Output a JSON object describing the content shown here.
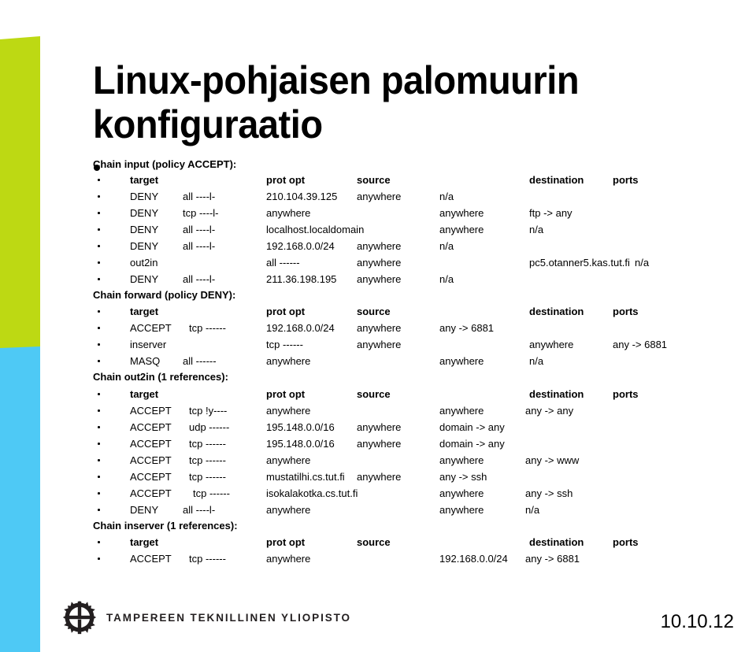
{
  "slide": {
    "title": "Linux-pohjaisen palomuurin konfiguraatio",
    "date": "10.10.12",
    "colors": {
      "accent_green": "#bdd913",
      "accent_blue": "#4ec9f5",
      "text": "#000000"
    }
  },
  "footer": {
    "wordmark": "TAMPEREEN TEKNILLINEN YLIOPISTO",
    "logo_icon": "gear-icon"
  },
  "sections": [
    {
      "heading": "Chain input (policy ACCEPT):",
      "columns": [
        "target",
        "prot opt",
        "source",
        "destination",
        "ports"
      ],
      "rows": [
        {
          "target": "DENY",
          "prot": "all  ----l-",
          "source": "210.104.39.125",
          "extra": "anywhere",
          "destination": "n/a",
          "ports": ""
        },
        {
          "target": "DENY",
          "prot": "tcp  ----l-",
          "source": "anywhere",
          "extra": "",
          "destination": "anywhere",
          "ports": "ftp ->   any"
        },
        {
          "target": "DENY",
          "prot": "all  ----l-",
          "source": "localhost.localdomain",
          "extra": "",
          "destination": "anywhere",
          "ports": "n/a"
        },
        {
          "target": "DENY",
          "prot": "all  ----l-",
          "source": "192.168.0.0/24",
          "extra": "anywhere",
          "destination": "n/a",
          "ports": ""
        },
        {
          "target": "out2in",
          "prot": "",
          "source": "all  ------",
          "extra": "anywhere",
          "destination": "pc5.otanner5.kas.tut.fi",
          "ports": "n/a"
        },
        {
          "target": "DENY",
          "prot": "all  ----l-",
          "source": "211.36.198.195",
          "extra": "anywhere",
          "destination": "n/a",
          "ports": ""
        }
      ]
    },
    {
      "heading": "Chain forward (policy DENY):",
      "columns": [
        "target",
        "prot opt",
        "source",
        "destination",
        "ports"
      ],
      "rows": [
        {
          "target": "ACCEPT",
          "prot": "tcp  ------",
          "source": "192.168.0.0/24",
          "extra": "anywhere",
          "destination": "any ->   6881",
          "ports": ""
        },
        {
          "target": "inserver",
          "prot": "",
          "source": "tcp  ------",
          "extra": "anywhere",
          "destination": "anywhere",
          "ports": "any ->   6881"
        },
        {
          "target": "MASQ",
          "prot": "all  ------",
          "source": "anywhere",
          "extra": "",
          "destination": "anywhere",
          "ports": "n/a"
        }
      ]
    },
    {
      "heading": "Chain out2in (1 references):",
      "columns": [
        "target",
        "prot opt",
        "source",
        "destination",
        "ports"
      ],
      "rows": [
        {
          "target": "ACCEPT",
          "prot": "tcp  !y----",
          "source": "anywhere",
          "extra": "",
          "destination": "anywhere",
          "ports": "any ->   any"
        },
        {
          "target": "ACCEPT",
          "prot": "udp  ------",
          "source": "195.148.0.0/16",
          "extra": "anywhere",
          "destination": "domain ->   any",
          "ports": ""
        },
        {
          "target": "ACCEPT",
          "prot": "tcp  ------",
          "source": "195.148.0.0/16",
          "extra": "anywhere",
          "destination": "domain ->   any",
          "ports": ""
        },
        {
          "target": "ACCEPT",
          "prot": "tcp  ------",
          "source": "anywhere",
          "extra": "",
          "destination": "anywhere",
          "ports": "any ->   www"
        },
        {
          "target": "ACCEPT",
          "prot": "tcp  ------",
          "source": "mustatilhi.cs.tut.fi",
          "extra": "anywhere",
          "destination": "any ->   ssh",
          "ports": ""
        },
        {
          "target": "ACCEPT",
          "prot": "tcp  ------",
          "source": "isokalakotka.cs.tut.fi",
          "extra": "",
          "destination": "anywhere",
          "ports": "any ->   ssh"
        },
        {
          "target": "DENY",
          "prot": "all  ----l-",
          "source": "anywhere",
          "extra": "",
          "destination": "anywhere",
          "ports": "n/a"
        }
      ]
    },
    {
      "heading": "Chain inserver (1 references):",
      "columns": [
        "target",
        "prot opt",
        "source",
        "destination",
        "ports"
      ],
      "rows": [
        {
          "target": "ACCEPT",
          "prot": "tcp  ------",
          "source": "anywhere",
          "extra": "",
          "destination": "192.168.0.0/24",
          "ports": "any ->   6881"
        }
      ]
    }
  ],
  "layout": {
    "heading_tops": [
      202,
      368,
      472,
      661
    ],
    "header_tops": [
      221,
      388,
      493,
      681
    ],
    "row_blocks": [
      [
        242,
        263,
        284,
        305,
        326,
        347
      ],
      [
        409,
        430,
        451
      ],
      [
        514,
        535,
        556,
        577,
        598,
        619,
        640
      ],
      [
        702
      ]
    ],
    "header_x": {
      "target": 165,
      "prot": 338,
      "source": 453,
      "destination": 672,
      "ports": 778
    },
    "row_x": [
      [
        {
          "target": 165,
          "prot": 232,
          "source": 338,
          "extra": 453,
          "destination": 558,
          "ports": 0
        },
        {
          "target": 165,
          "prot": 232,
          "source": 338,
          "extra": 0,
          "destination": 558,
          "ports": 672
        },
        {
          "target": 165,
          "prot": 232,
          "source": 338,
          "extra": 0,
          "destination": 558,
          "ports": 672
        },
        {
          "target": 165,
          "prot": 232,
          "source": 338,
          "extra": 453,
          "destination": 558,
          "ports": 0
        },
        {
          "target": 165,
          "prot": 0,
          "source": 338,
          "extra": 453,
          "destination": 672,
          "ports": 806
        },
        {
          "target": 165,
          "prot": 232,
          "source": 338,
          "extra": 453,
          "destination": 558,
          "ports": 0
        }
      ],
      [
        {
          "target": 165,
          "prot": 240,
          "source": 338,
          "extra": 453,
          "destination": 558,
          "ports": 0
        },
        {
          "target": 165,
          "prot": 0,
          "source": 338,
          "extra": 453,
          "destination": 672,
          "ports": 778
        },
        {
          "target": 165,
          "prot": 232,
          "source": 338,
          "extra": 0,
          "destination": 558,
          "ports": 672
        }
      ],
      [
        {
          "target": 165,
          "prot": 240,
          "source": 338,
          "extra": 0,
          "destination": 558,
          "ports": 667
        },
        {
          "target": 165,
          "prot": 240,
          "source": 338,
          "extra": 453,
          "destination": 558,
          "ports": 0
        },
        {
          "target": 165,
          "prot": 240,
          "source": 338,
          "extra": 453,
          "destination": 558,
          "ports": 0
        },
        {
          "target": 165,
          "prot": 240,
          "source": 338,
          "extra": 0,
          "destination": 558,
          "ports": 667
        },
        {
          "target": 165,
          "prot": 240,
          "source": 338,
          "extra": 453,
          "destination": 558,
          "ports": 0
        },
        {
          "target": 165,
          "prot": 245,
          "source": 338,
          "extra": 0,
          "destination": 558,
          "ports": 667
        },
        {
          "target": 165,
          "prot": 232,
          "source": 338,
          "extra": 0,
          "destination": 558,
          "ports": 667
        }
      ],
      [
        {
          "target": 165,
          "prot": 240,
          "source": 338,
          "extra": 0,
          "destination": 558,
          "ports": 667
        }
      ]
    ]
  }
}
